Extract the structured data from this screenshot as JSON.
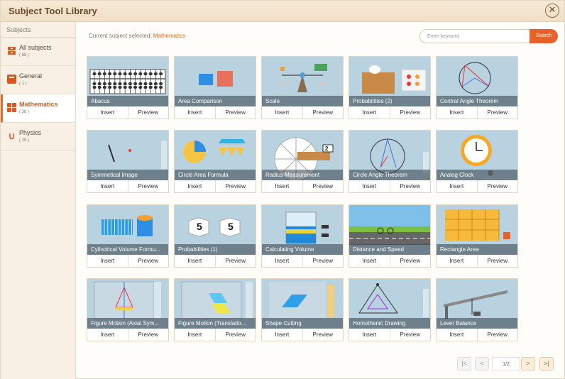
{
  "app": {
    "title": "Subject Tool Library",
    "close_icon": "close-icon"
  },
  "sidebar": {
    "header": "Subjects",
    "items": [
      {
        "label": "All subjects",
        "count": "( 68 )",
        "icon": "boxes-icon"
      },
      {
        "label": "General",
        "count": "( 1 )",
        "icon": "book-icon"
      },
      {
        "label": "Mathematics",
        "count": "( 38 )",
        "icon": "grid-icon",
        "active": true
      },
      {
        "label": "Physics",
        "count": "( 29 )",
        "icon": "magnet-icon"
      }
    ]
  },
  "main": {
    "subject_prefix": "Current subject selected:",
    "subject_value": "Mathematics",
    "search": {
      "placeholder": "Enter keyword",
      "button": "Search"
    }
  },
  "tools": [
    {
      "title": "Abacus",
      "insert": "Insert",
      "preview": "Preview"
    },
    {
      "title": "Area Comparison",
      "insert": "Insert",
      "preview": "Preview"
    },
    {
      "title": "Scale",
      "insert": "Insert",
      "preview": "Preview"
    },
    {
      "title": "Probabilities (2)",
      "insert": "Insert",
      "preview": "Preview"
    },
    {
      "title": "Central Angle Theorem",
      "insert": "Insert",
      "preview": "Preview"
    },
    {
      "title": "Symmetical Image",
      "insert": "Insert",
      "preview": "Preview"
    },
    {
      "title": "Circle Area Formula",
      "insert": "Insert",
      "preview": "Preview"
    },
    {
      "title": "Radius Measurement",
      "insert": "Insert",
      "preview": "Preview"
    },
    {
      "title": "Circle Angle Theorem",
      "insert": "Insert",
      "preview": "Preview"
    },
    {
      "title": "Analog Clock",
      "insert": "Insert",
      "preview": "Preview"
    },
    {
      "title": "Cylindrical Volume Formu...",
      "insert": "Insert",
      "preview": "Preview"
    },
    {
      "title": "Probabilities (1)",
      "insert": "Insert",
      "preview": "Preview"
    },
    {
      "title": "Calculating Volume",
      "insert": "Insert",
      "preview": "Preview"
    },
    {
      "title": "Distance and Speed",
      "insert": "Insert",
      "preview": "Preview"
    },
    {
      "title": "Rectangle Area",
      "insert": "Insert",
      "preview": "Preview"
    },
    {
      "title": "Figure Motion (Axial Sym...",
      "insert": "Insert",
      "preview": "Preview"
    },
    {
      "title": "Figure Motion (Translatio...",
      "insert": "Insert",
      "preview": "Preview"
    },
    {
      "title": "Shape Cutting",
      "insert": "Insert",
      "preview": "Preview"
    },
    {
      "title": "Homothenic Drawing",
      "insert": "Insert",
      "preview": "Preview"
    },
    {
      "title": "Lever Balance",
      "insert": "Insert",
      "preview": "Preview"
    }
  ],
  "thumb_labels": {
    "radius_value": "2",
    "dice_value": "5"
  },
  "pagination": {
    "page": "1/2",
    "first": "|<",
    "prev": "<",
    "next": ">",
    "last": ">|"
  },
  "colors": {
    "accent": "#e8612a",
    "thumb_bg": "#b9d2e0"
  }
}
